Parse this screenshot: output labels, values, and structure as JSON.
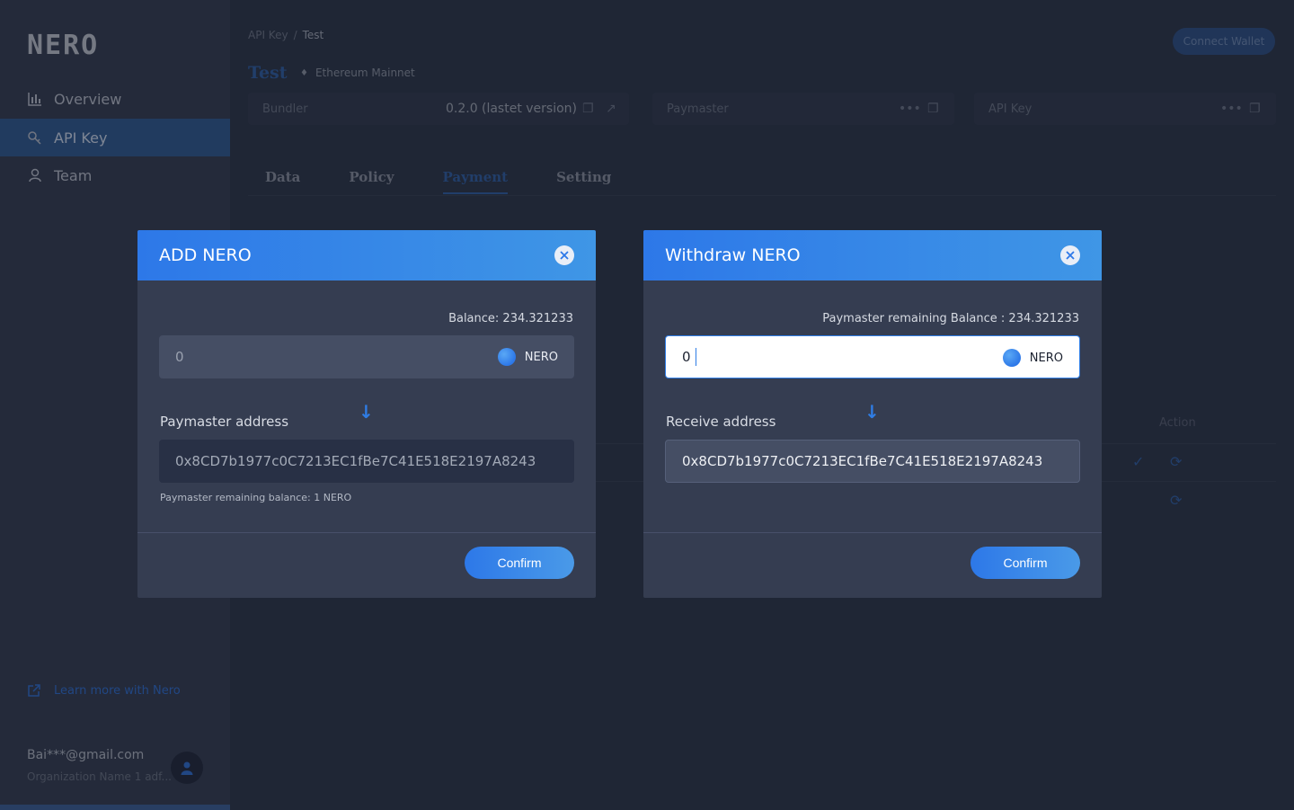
{
  "sidebar": {
    "logo": "NERO",
    "items": [
      {
        "label": "Overview",
        "icon": "chart-bar-icon"
      },
      {
        "label": "API Key",
        "icon": "key-icon",
        "active": true
      },
      {
        "label": "Team",
        "icon": "user-icon"
      }
    ],
    "learn_more": "Learn more with Nero",
    "user_email": "Bai***@gmail.com",
    "org_name": "Organization Name 1 adf..."
  },
  "header": {
    "breadcrumb": [
      "API Key",
      "Test"
    ],
    "breadcrumb_sep": "/",
    "connect_wallet": "Connect Wallet",
    "title": "Test",
    "network": "Ethereum Mainnet"
  },
  "info_cards": {
    "bundler_label": "Bundler",
    "bundler_version": "0.2.0",
    "bundler_note": "(lastet version)",
    "paymaster_label": "Paymaster",
    "apikey_label": "API Key",
    "masked": "•••"
  },
  "tabs": [
    "Data",
    "Policy",
    "Payment",
    "Setting"
  ],
  "active_tab": "Payment",
  "background_table": {
    "action_header": "Action"
  },
  "add_modal": {
    "title": "ADD NERO",
    "balance": "Balance: 234.321233",
    "amount": "0",
    "token": "NERO",
    "address_label": "Paymaster address",
    "address": "0x8CD7b1977c0C7213EC1fBe7C41E518E2197A8243",
    "hint": "Paymaster remaining balance: 1 NERO",
    "confirm": "Confirm"
  },
  "withdraw_modal": {
    "title": "Withdraw NERO",
    "balance": "Paymaster remaining Balance : 234.321233",
    "amount": "0",
    "token": "NERO",
    "address_label": "Receive address",
    "address": "0x8CD7b1977c0C7213EC1fBe7C41E518E2197A8243",
    "confirm": "Confirm"
  },
  "colors": {
    "accent": "#2d78e8",
    "sidebar_bg": "#333b4f",
    "modal_bg": "#353d51"
  }
}
